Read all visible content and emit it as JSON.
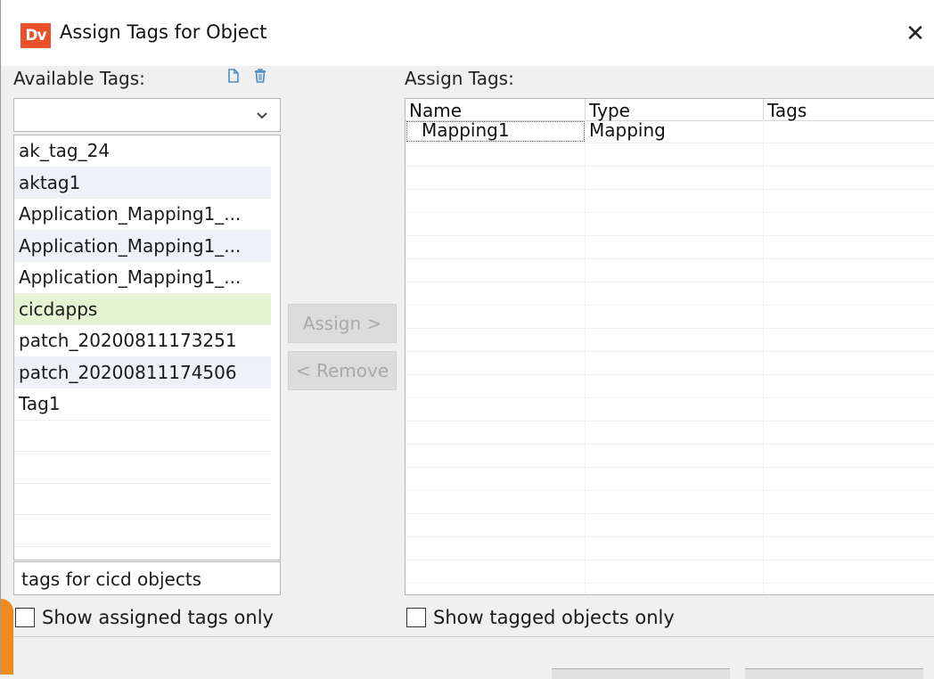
{
  "window": {
    "title": "Assign Tags for Object",
    "logo_text": "Dv",
    "close_label": "✕"
  },
  "available": {
    "label": "Available Tags:",
    "icons": [
      "new-tag-icon",
      "delete-tag-icon"
    ],
    "filter_value": "",
    "tags": [
      "ak_tag_24",
      "aktag1",
      "Application_Mapping1_...",
      "Application_Mapping1_...",
      "Application_Mapping1_...",
      "cicdapps",
      "patch_20200811173251",
      "patch_20200811174506",
      "Tag1"
    ],
    "selected_index": 5,
    "description": "tags for cicd objects",
    "show_assigned_label": "Show assigned tags only"
  },
  "actions": {
    "assign_label": "Assign >",
    "remove_label": "< Remove"
  },
  "assign": {
    "label": "Assign Tags:",
    "columns": [
      "Name",
      "Type",
      "Tags"
    ],
    "rows": [
      [
        "Mapping1",
        "Mapping",
        ""
      ]
    ],
    "show_tagged_label": "Show tagged objects only"
  },
  "colors": {
    "selected_row": "#e4f3d2",
    "alt_row": "#eef1f6",
    "logo": "#e8512a",
    "disabled_button": "#dcdcdc"
  }
}
